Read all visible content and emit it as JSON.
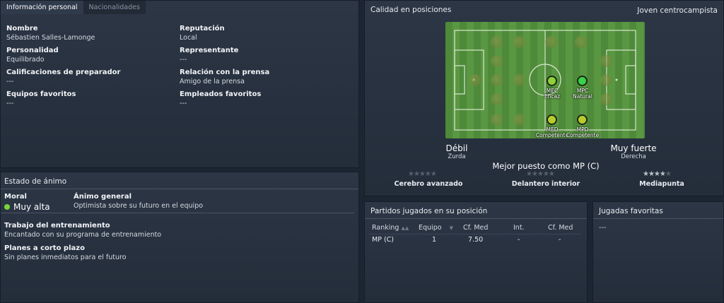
{
  "tabs": [
    {
      "label": "Información personal"
    },
    {
      "label": "Nacionalidades"
    }
  ],
  "personal": {
    "nombre": {
      "label": "Nombre",
      "value": "Sébastien Salles-Lamonge"
    },
    "reputacion": {
      "label": "Reputación",
      "value": "Local"
    },
    "personalidad": {
      "label": "Personalidad",
      "value": "Equilibrado"
    },
    "representante": {
      "label": "Representante",
      "value": "---"
    },
    "calificaciones": {
      "label": "Calificaciones de preparador",
      "value": "---"
    },
    "relacion": {
      "label": "Relación con la prensa",
      "value": "Amigo de la prensa"
    },
    "equipos": {
      "label": "Equipos favoritos",
      "value": "---"
    },
    "empleados": {
      "label": "Empleados favoritos",
      "value": "---"
    }
  },
  "animo": {
    "title": "Estado de ánimo",
    "moral_label": "Moral",
    "moral_value": "Muy alta",
    "moral_color": "#7ad33c",
    "general_label": "Ánimo general",
    "general_value": "Optimista sobre su futuro en el equipo",
    "trabajo_label": "Trabajo del entrenamiento",
    "trabajo_value": "Encantado con su programa de entrenamiento",
    "planes_label": "Planes a corto plazo",
    "planes_value": "Sin planes inmediatos para el futuro"
  },
  "posiciones": {
    "title": "Calidad en posiciones",
    "role": "Joven centrocampista",
    "positions": [
      {
        "code": "MEC",
        "rating": "Eficaz",
        "color": "#8fd13a"
      },
      {
        "code": "MPC",
        "rating": "Natural",
        "color": "#39d24a"
      },
      {
        "code": "MED",
        "rating": "Competente",
        "color": "#b8cc2e"
      },
      {
        "code": "MPD",
        "rating": "Competente",
        "color": "#b8cc2e"
      }
    ],
    "left_foot_strength": "Débil",
    "left_foot": "Zurda",
    "right_foot_strength": "Muy fuerte",
    "right_foot": "Derecha",
    "best": "Mejor puesto como MP (C)",
    "roles": [
      {
        "name": "Cerebro avanzado",
        "stars": 0
      },
      {
        "name": "Delantero interior",
        "stars": 0
      },
      {
        "name": "Mediapunta",
        "stars": 4
      }
    ]
  },
  "partidos": {
    "title": "Partidos jugados en su posición",
    "headers": [
      "Ranking",
      "Equipo",
      "Cf. Med",
      "Int.",
      "Cf. Med"
    ],
    "rows": [
      [
        "MP (C)",
        "1",
        "7.50",
        "-",
        "-"
      ]
    ]
  },
  "jugadas": {
    "title": "Jugadas favoritas",
    "value": "---"
  }
}
